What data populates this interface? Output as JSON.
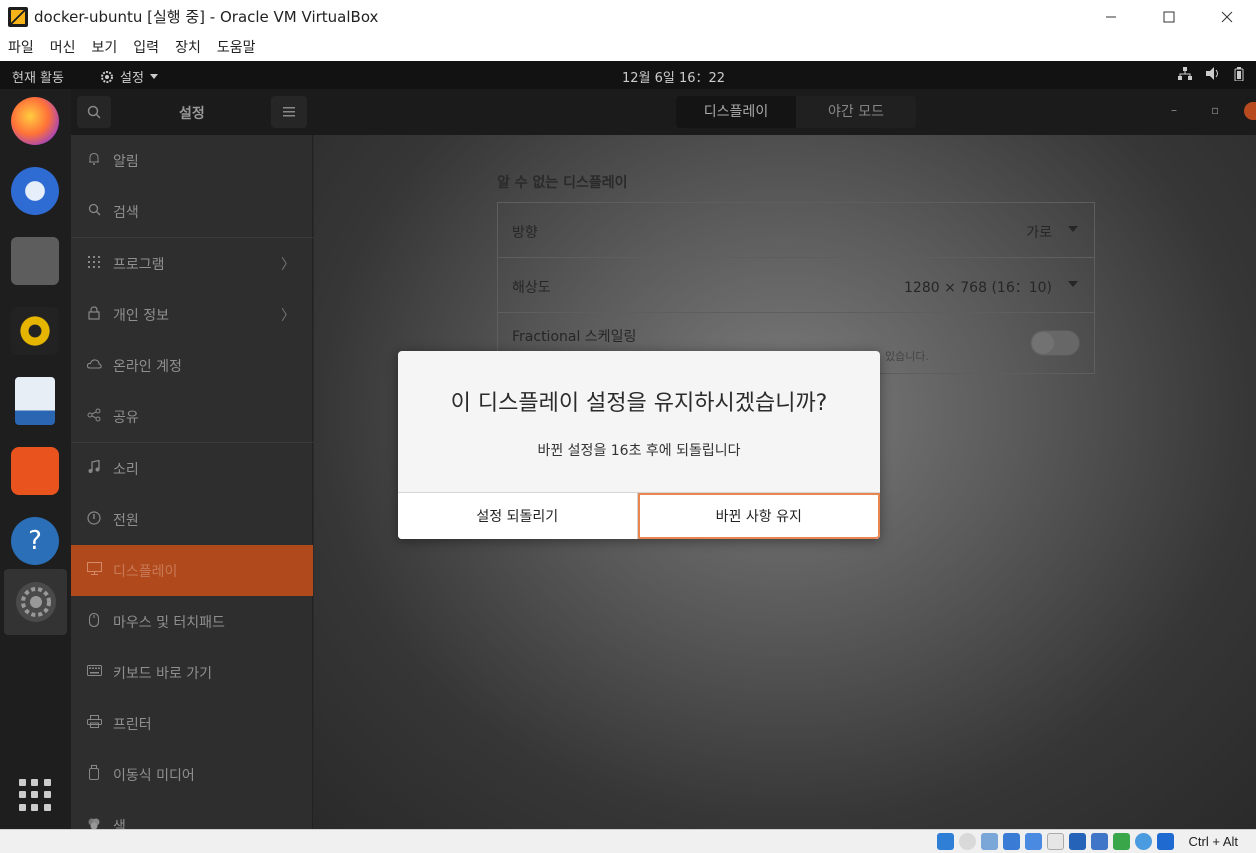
{
  "window": {
    "title": "docker-ubuntu [실행 중] - Oracle VM VirtualBox",
    "min_icon": "minimize-icon",
    "max_icon": "maximize-icon",
    "close_icon": "close-icon"
  },
  "menu": [
    "파일",
    "머신",
    "보기",
    "입력",
    "장치",
    "도움말"
  ],
  "topbar": {
    "activities": "현재 활동",
    "app_menu": "설정",
    "clock": "12월 6일  16：22"
  },
  "dock": {
    "icons": [
      "firefox-icon",
      "thunderbird-icon",
      "files-icon",
      "rhythmbox-icon",
      "libreoffice-writer-icon",
      "software-center-icon",
      "help-icon",
      "settings-icon"
    ],
    "apps_grid": "show-applications-icon"
  },
  "headerbar": {
    "title": "설정",
    "tabs": [
      "디스플레이",
      "야간 모드"
    ]
  },
  "sidebar": {
    "items": [
      {
        "label": "알림",
        "icon": "bell-icon"
      },
      {
        "label": "검색",
        "icon": "search-icon"
      },
      {
        "label": "프로그램",
        "icon": "grid-icon"
      },
      {
        "label": "개인 정보",
        "icon": "lock-icon"
      },
      {
        "label": "온라인 계정",
        "icon": "cloud-icon"
      },
      {
        "label": "공유",
        "icon": "share-icon"
      },
      {
        "label": "소리",
        "icon": "music-note-icon"
      },
      {
        "label": "전원",
        "icon": "power-icon"
      },
      {
        "label": "디스플레이",
        "icon": "monitor-icon"
      },
      {
        "label": "마우스 및 터치패드",
        "icon": "mouse-icon"
      },
      {
        "label": "키보드 바로 가기",
        "icon": "keyboard-icon"
      },
      {
        "label": "프린터",
        "icon": "printer-icon"
      },
      {
        "label": "이동식 미디어",
        "icon": "usb-drive-icon"
      },
      {
        "label": "색",
        "icon": "color-icon"
      }
    ],
    "active": "디스플레이"
  },
  "display": {
    "section_title": "알 수 없는 디스플레이",
    "orientation_label": "방향",
    "orientation_value": "가로",
    "resolution_label": "해상도",
    "resolution_value": "1280 × 768 (16：10)",
    "scaling_label": "Fractional 스케일링",
    "scaling_sub": "있습니다.",
    "scaling_enabled": false
  },
  "dialog": {
    "title": "이 디스플레이 설정을 유지하시겠습니까?",
    "message": "바뀐 설정을 16초 후에 되돌립니다",
    "revert_button": "설정 되돌리기",
    "keep_button": "바뀐 사항 유지"
  },
  "statusbar": {
    "host_key": "Ctrl + Alt"
  },
  "colors": {
    "accent": "#b0491b",
    "focus_border": "#e9854f"
  }
}
